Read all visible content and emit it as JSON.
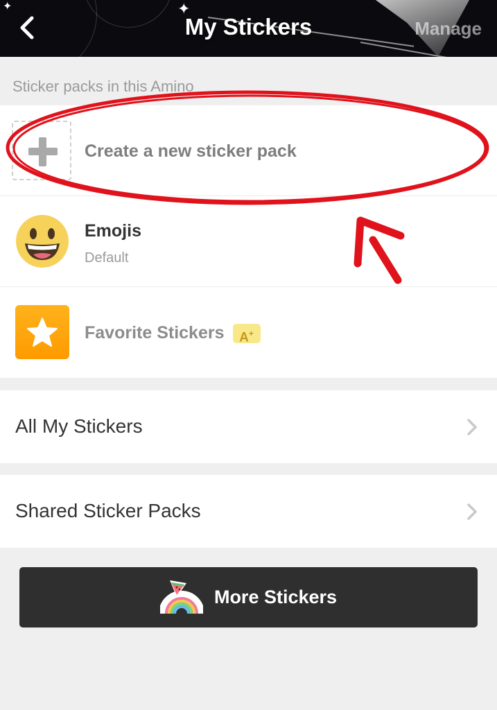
{
  "header": {
    "title": "My Stickers",
    "manage_label": "Manage",
    "back_icon": "chevron-left-icon"
  },
  "section_label": "Sticker packs in this Amino",
  "packs": [
    {
      "title": "Create a new sticker pack",
      "subtitle": "",
      "icon": "plus-icon"
    },
    {
      "title": "Emojis",
      "subtitle": "Default",
      "icon": "grinning-face-icon"
    },
    {
      "title": "Favorite Stickers",
      "subtitle": "",
      "icon": "star-icon",
      "badge_icon": "amino-plus-icon"
    }
  ],
  "nav": [
    {
      "label": "All My Stickers",
      "icon": "chevron-right-icon"
    },
    {
      "label": "Shared Sticker Packs",
      "icon": "chevron-right-icon"
    }
  ],
  "more_button": {
    "label": "More Stickers",
    "icon": "rainbow-watermelon-sticker-icon"
  },
  "colors": {
    "header_bg": "#0b0b0f",
    "page_bg": "#efefef",
    "favorite_orange": "#ff9a00",
    "button_dark": "#2f2f2f",
    "annotation_red": "#e0121b"
  }
}
